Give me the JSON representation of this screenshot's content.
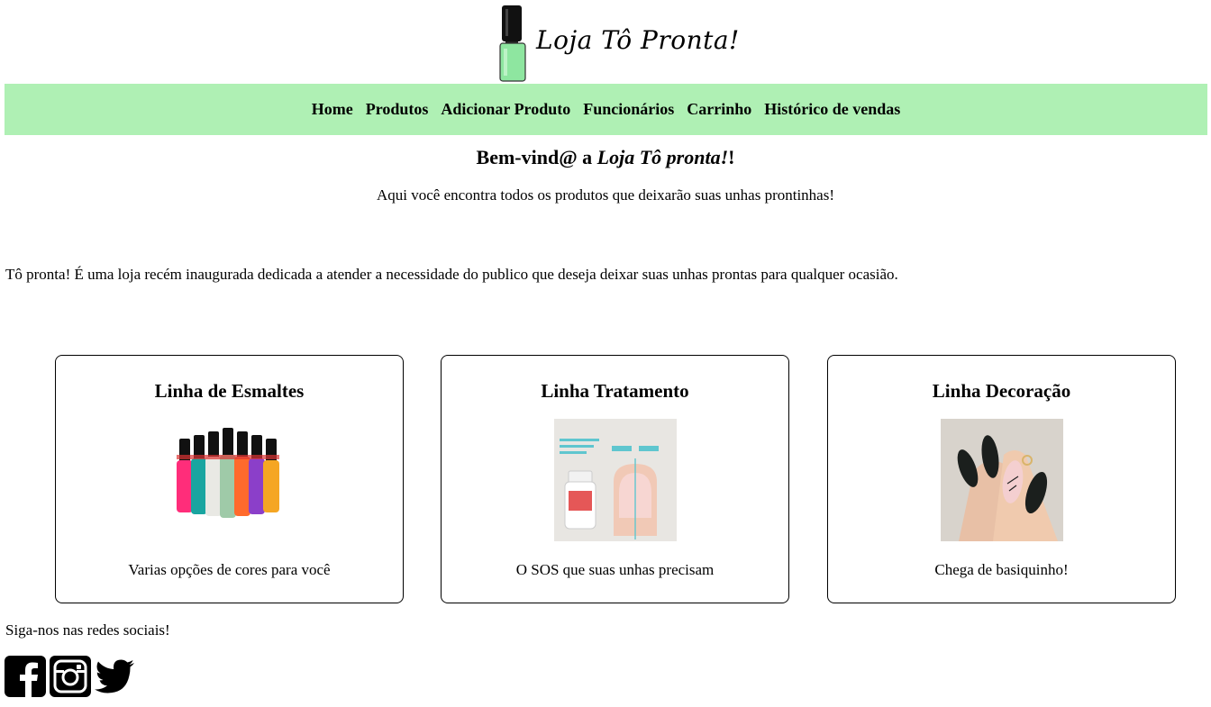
{
  "brand": {
    "name": "Loja Tô Pronta!"
  },
  "nav": {
    "items": [
      "Home",
      "Produtos",
      "Adicionar Produto",
      "Funcionários",
      "Carrinho",
      "Histórico de vendas"
    ]
  },
  "hero": {
    "welcome_prefix": "Bem-vind@ a ",
    "welcome_store": "Loja Tô pronta!",
    "welcome_suffix": "!",
    "subtitle": "Aqui você encontra todos os produtos que deixarão suas unhas prontinhas!"
  },
  "about": "Tô pronta! É uma loja recém inaugurada dedicada a atender a necessidade do publico que deseja deixar suas unhas prontas para qualquer ocasião.",
  "cards": [
    {
      "title": "Linha de Esmaltes",
      "description": "Varias opções de cores para você",
      "image": "nail-polish-bottles"
    },
    {
      "title": "Linha Tratamento",
      "description": "O SOS que suas unhas precisam",
      "image": "treatment-before-after"
    },
    {
      "title": "Linha Decoração",
      "description": "Chega de basiquinho!",
      "image": "decorated-nails"
    }
  ],
  "footer": {
    "follow_text": "Siga-nos nas redes sociais!",
    "social_icons": [
      "facebook-icon",
      "instagram-icon",
      "twitter-icon"
    ]
  },
  "colors": {
    "nav_background": "#aff0b4",
    "accent_green": "#8ee6a0"
  }
}
